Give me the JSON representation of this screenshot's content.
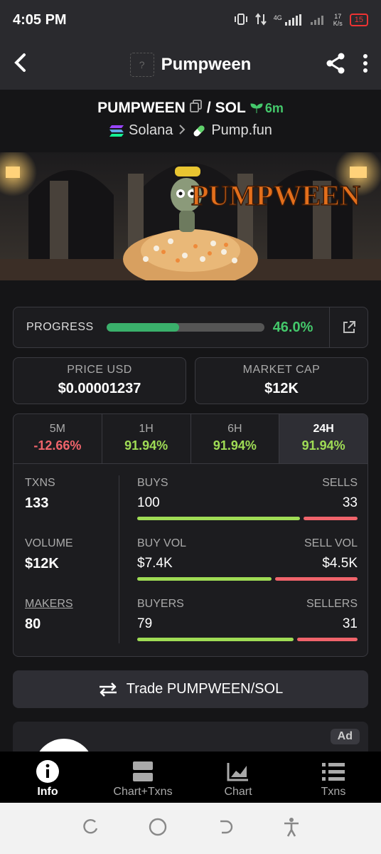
{
  "status_bar": {
    "time": "4:05 PM",
    "net_speed": "17",
    "net_unit": "K/s",
    "battery": "15",
    "network": "4G"
  },
  "app_bar": {
    "title": "Pumpween",
    "placeholder_icon": "?"
  },
  "pair": {
    "base": "PUMPWEEN",
    "separator": "/",
    "quote": "SOL",
    "age": "6m",
    "chain": "Solana",
    "dex": "Pump.fun"
  },
  "banner": {
    "text": "PUMPWEEN"
  },
  "progress": {
    "label": "PROGRESS",
    "value_text": "46.0%",
    "value": 0.46
  },
  "price": {
    "label": "PRICE USD",
    "value": "$0.00001237"
  },
  "market_cap": {
    "label": "MARKET CAP",
    "value": "$12K"
  },
  "periods": [
    {
      "label": "5M",
      "change": "-12.66%"
    },
    {
      "label": "1H",
      "change": "91.94%"
    },
    {
      "label": "6H",
      "change": "91.94%"
    },
    {
      "label": "24H",
      "change": "91.94%"
    }
  ],
  "metrics": {
    "txns": {
      "label": "TXNS",
      "value": "133",
      "left_label": "BUYS",
      "right_label": "SELLS",
      "left_value": "100",
      "right_value": "33",
      "left_ratio": 0.75
    },
    "volume": {
      "label": "VOLUME",
      "value": "$12K",
      "left_label": "BUY VOL",
      "right_label": "SELL VOL",
      "left_value": "$7.4K",
      "right_value": "$4.5K",
      "left_ratio": 0.62
    },
    "makers": {
      "label": "MAKERS",
      "value": "80",
      "left_label": "BUYERS",
      "right_label": "SELLERS",
      "left_value": "79",
      "right_value": "31",
      "left_ratio": 0.72
    }
  },
  "trade_button": {
    "label": "Trade PUMPWEEN/SOL"
  },
  "ad": {
    "tag": "Ad"
  },
  "bottom_nav": [
    {
      "label": "Info",
      "icon": "info-icon"
    },
    {
      "label": "Chart+Txns",
      "icon": "chart-txns-icon"
    },
    {
      "label": "Chart",
      "icon": "chart-icon"
    },
    {
      "label": "Txns",
      "icon": "list-icon"
    }
  ],
  "colors": {
    "positive": "#44c86b",
    "negative": "#f0646b",
    "buy": "#9fdc55",
    "accent_green": "#3ab06b"
  }
}
